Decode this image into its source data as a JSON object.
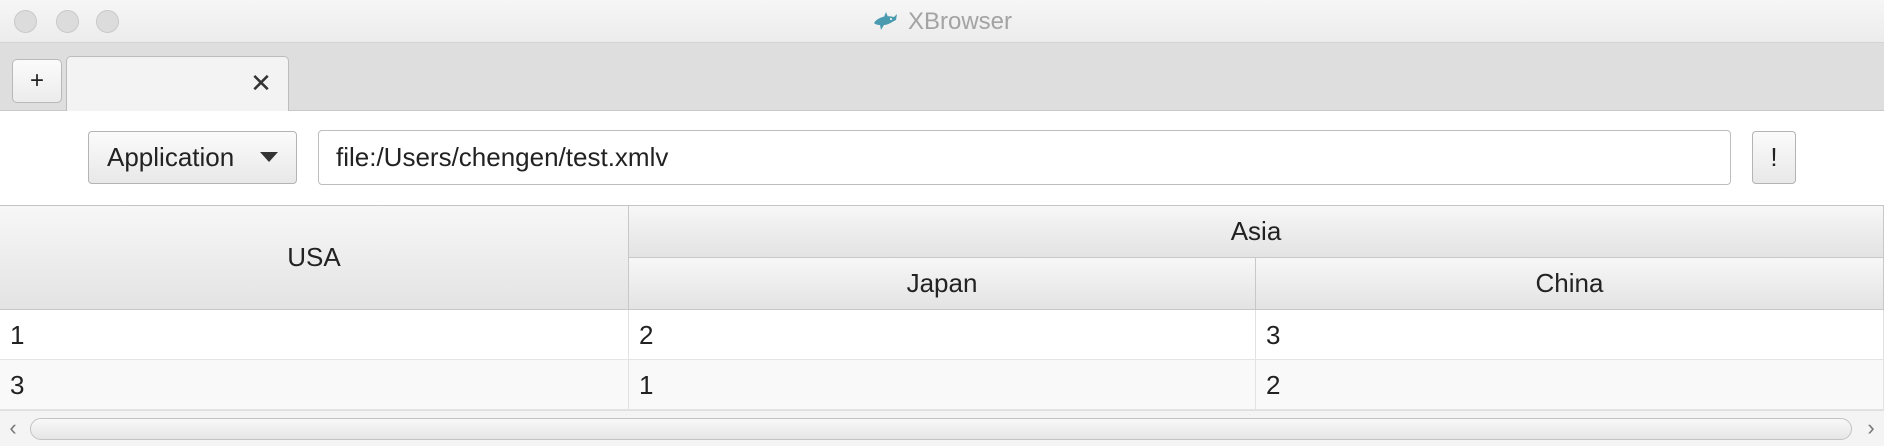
{
  "window": {
    "title": "XBrowser",
    "app_icon": "shark-icon"
  },
  "tabs": {
    "new_tab_label": "+",
    "items": [
      {
        "label": "",
        "close_label": "✕"
      }
    ]
  },
  "toolbar": {
    "mode_dropdown": {
      "selected": "Application"
    },
    "address": {
      "value": "file:/Users/chengen/test.xmlv"
    },
    "go_label": "!"
  },
  "table": {
    "columns": {
      "usa": "USA",
      "asia": "Asia",
      "japan": "Japan",
      "china": "China"
    },
    "rows": [
      [
        "1",
        "2",
        "3"
      ],
      [
        "3",
        "1",
        "2"
      ]
    ]
  },
  "scrollbar": {
    "left_arrow": "‹",
    "right_arrow": "›"
  }
}
